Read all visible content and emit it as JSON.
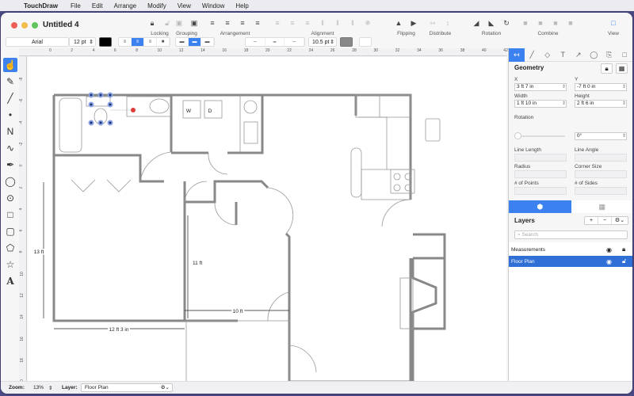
{
  "menubar": {
    "app_name": "TouchDraw",
    "items": [
      "File",
      "Edit",
      "Arrange",
      "Modify",
      "View",
      "Window",
      "Help"
    ]
  },
  "window": {
    "title": "Untitled 4"
  },
  "toolbar": {
    "groups": [
      {
        "label": "Locking",
        "icons": [
          "lock-icon",
          "unlock-icon"
        ]
      },
      {
        "label": "Grouping",
        "icons": [
          "group-icon",
          "ungroup-icon"
        ]
      },
      {
        "label": "Arrangement",
        "icons": [
          "bring-front-icon",
          "bring-forward-icon",
          "send-backward-icon",
          "send-back-icon"
        ]
      },
      {
        "label": "Alignment",
        "icons": [
          "align-left-icon",
          "align-center-icon",
          "align-right-icon",
          "align-top-icon",
          "align-middle-icon",
          "align-bottom-icon",
          "align-center-both-icon"
        ]
      },
      {
        "label": "Flipping",
        "icons": [
          "flip-horizontal-icon",
          "flip-vertical-icon"
        ]
      },
      {
        "label": "Distribute",
        "icons": [
          "distribute-horizontal-icon",
          "distribute-vertical-icon"
        ]
      },
      {
        "label": "Rotation",
        "icons": [
          "rotate-left-icon",
          "rotate-right-icon",
          "rotate-free-icon"
        ]
      },
      {
        "label": "Combine",
        "icons": [
          "union-icon",
          "subtract-icon",
          "intersect-icon",
          "exclude-icon"
        ]
      },
      {
        "label": "View",
        "icons": [
          "view-icon"
        ]
      }
    ]
  },
  "formatbar": {
    "font": "Arial",
    "font_size": "12 pt",
    "text_color": "#000000",
    "stroke_width": "10.5 pt",
    "stroke_color": "#888888",
    "fill_color": "#ffffff"
  },
  "rulers": {
    "top": [
      "0",
      "2",
      "4",
      "6",
      "8",
      "10",
      "12",
      "14",
      "16",
      "18",
      "20",
      "22",
      "24",
      "26",
      "28",
      "30",
      "32",
      "34",
      "36",
      "38",
      "40",
      "42"
    ],
    "left": [
      "-8",
      "-6",
      "-4",
      "-2",
      "0",
      "2",
      "4",
      "6",
      "8",
      "10",
      "12",
      "14",
      "16",
      "18",
      "20"
    ]
  },
  "tools": [
    "hand-select",
    "pencil",
    "line",
    "connector",
    "polyline",
    "curve",
    "pen",
    "circle",
    "circle-center",
    "rectangle",
    "rounded-rectangle",
    "polygon",
    "star",
    "text"
  ],
  "canvas": {
    "labels": {
      "washer": "W",
      "dryer": "D",
      "dim_13ft": "13 ft",
      "dim_11ft": "11 ft",
      "dim_10ft": "10 ft",
      "dim_12ft3in": "12 ft 3 in"
    }
  },
  "inspector": {
    "section_title": "Geometry",
    "fields": {
      "x_label": "X",
      "x_value": "3 ft 7 in",
      "y_label": "Y",
      "y_value": "-7 ft 0 in",
      "width_label": "Width",
      "width_value": "1 ft 10 in",
      "height_label": "Height",
      "height_value": "2 ft 6 in",
      "rotation_label": "Rotation",
      "rotation_value": "0°",
      "line_length_label": "Line Length",
      "line_angle_label": "Line Angle",
      "radius_label": "Radius",
      "corner_size_label": "Corner Size",
      "points_label": "# of Points",
      "sides_label": "# of Sides"
    },
    "rotation_fraction": 0
  },
  "layers": {
    "title": "Layers",
    "search_placeholder": "Search",
    "items": [
      {
        "name": "Measurements",
        "selected": false
      },
      {
        "name": "Floor Plan",
        "selected": true
      }
    ]
  },
  "statusbar": {
    "zoom_label": "Zoom:",
    "zoom_value": "13%",
    "layer_label": "Layer:",
    "layer_value": "Floor Plan"
  },
  "colors": {
    "accent": "#3b82f0",
    "selected_row": "#2f6fd6",
    "wall": "#888888",
    "desktop": "#4c4a86"
  }
}
